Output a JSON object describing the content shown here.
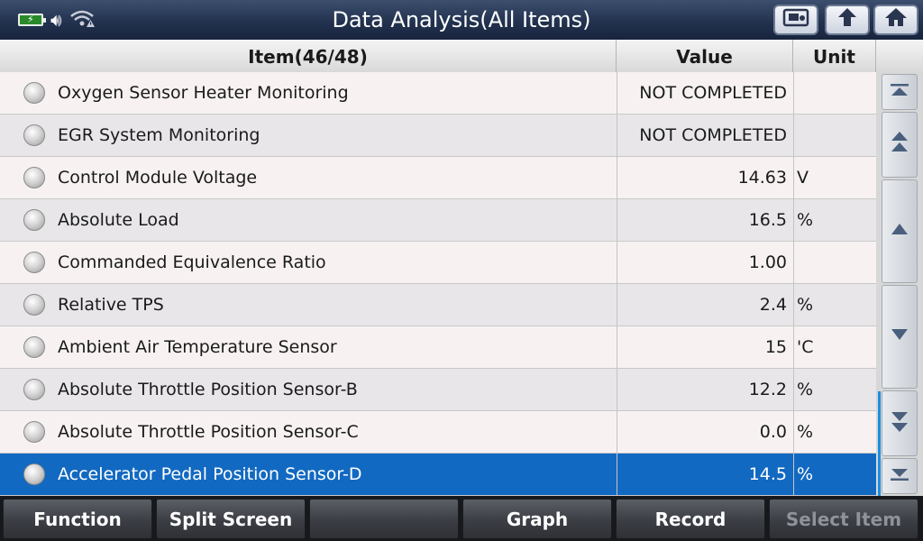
{
  "header": {
    "title": "Data Analysis(All Items)",
    "status_icons": [
      "battery-charging-icon",
      "speaker-icon",
      "wifi-warning-icon"
    ],
    "buttons": [
      "screen-capture-icon",
      "back-up-icon",
      "home-icon"
    ]
  },
  "table": {
    "columns": {
      "item": "Item(46/48)",
      "value": "Value",
      "unit": "Unit"
    },
    "rows": [
      {
        "item": "Oxygen Sensor Heater Monitoring",
        "value": "NOT COMPLETED",
        "unit": ""
      },
      {
        "item": "EGR System Monitoring",
        "value": "NOT COMPLETED",
        "unit": ""
      },
      {
        "item": "Control Module Voltage",
        "value": "14.63",
        "unit": "V"
      },
      {
        "item": "Absolute Load",
        "value": "16.5",
        "unit": "%"
      },
      {
        "item": "Commanded Equivalence Ratio",
        "value": "1.00",
        "unit": ""
      },
      {
        "item": "Relative TPS",
        "value": "2.4",
        "unit": "%"
      },
      {
        "item": "Ambient Air Temperature Sensor",
        "value": "15",
        "unit": "'C"
      },
      {
        "item": "Absolute Throttle Position Sensor-B",
        "value": "12.2",
        "unit": "%"
      },
      {
        "item": "Absolute Throttle Position Sensor-C",
        "value": "0.0",
        "unit": "%"
      },
      {
        "item": "Accelerator Pedal Position Sensor-D",
        "value": "14.5",
        "unit": "%"
      }
    ],
    "selected_row_index": 9
  },
  "scroll_buttons": [
    "scroll-top-icon",
    "page-up-icon",
    "line-up-icon",
    "line-down-icon",
    "page-down-icon",
    "scroll-bottom-icon"
  ],
  "toolbar": {
    "function": "Function",
    "split_screen": "Split Screen",
    "empty": "",
    "graph": "Graph",
    "record": "Record",
    "select_item": "Select Item"
  },
  "colors": {
    "accent": "#1269c1",
    "title_bar": "#22324f"
  }
}
